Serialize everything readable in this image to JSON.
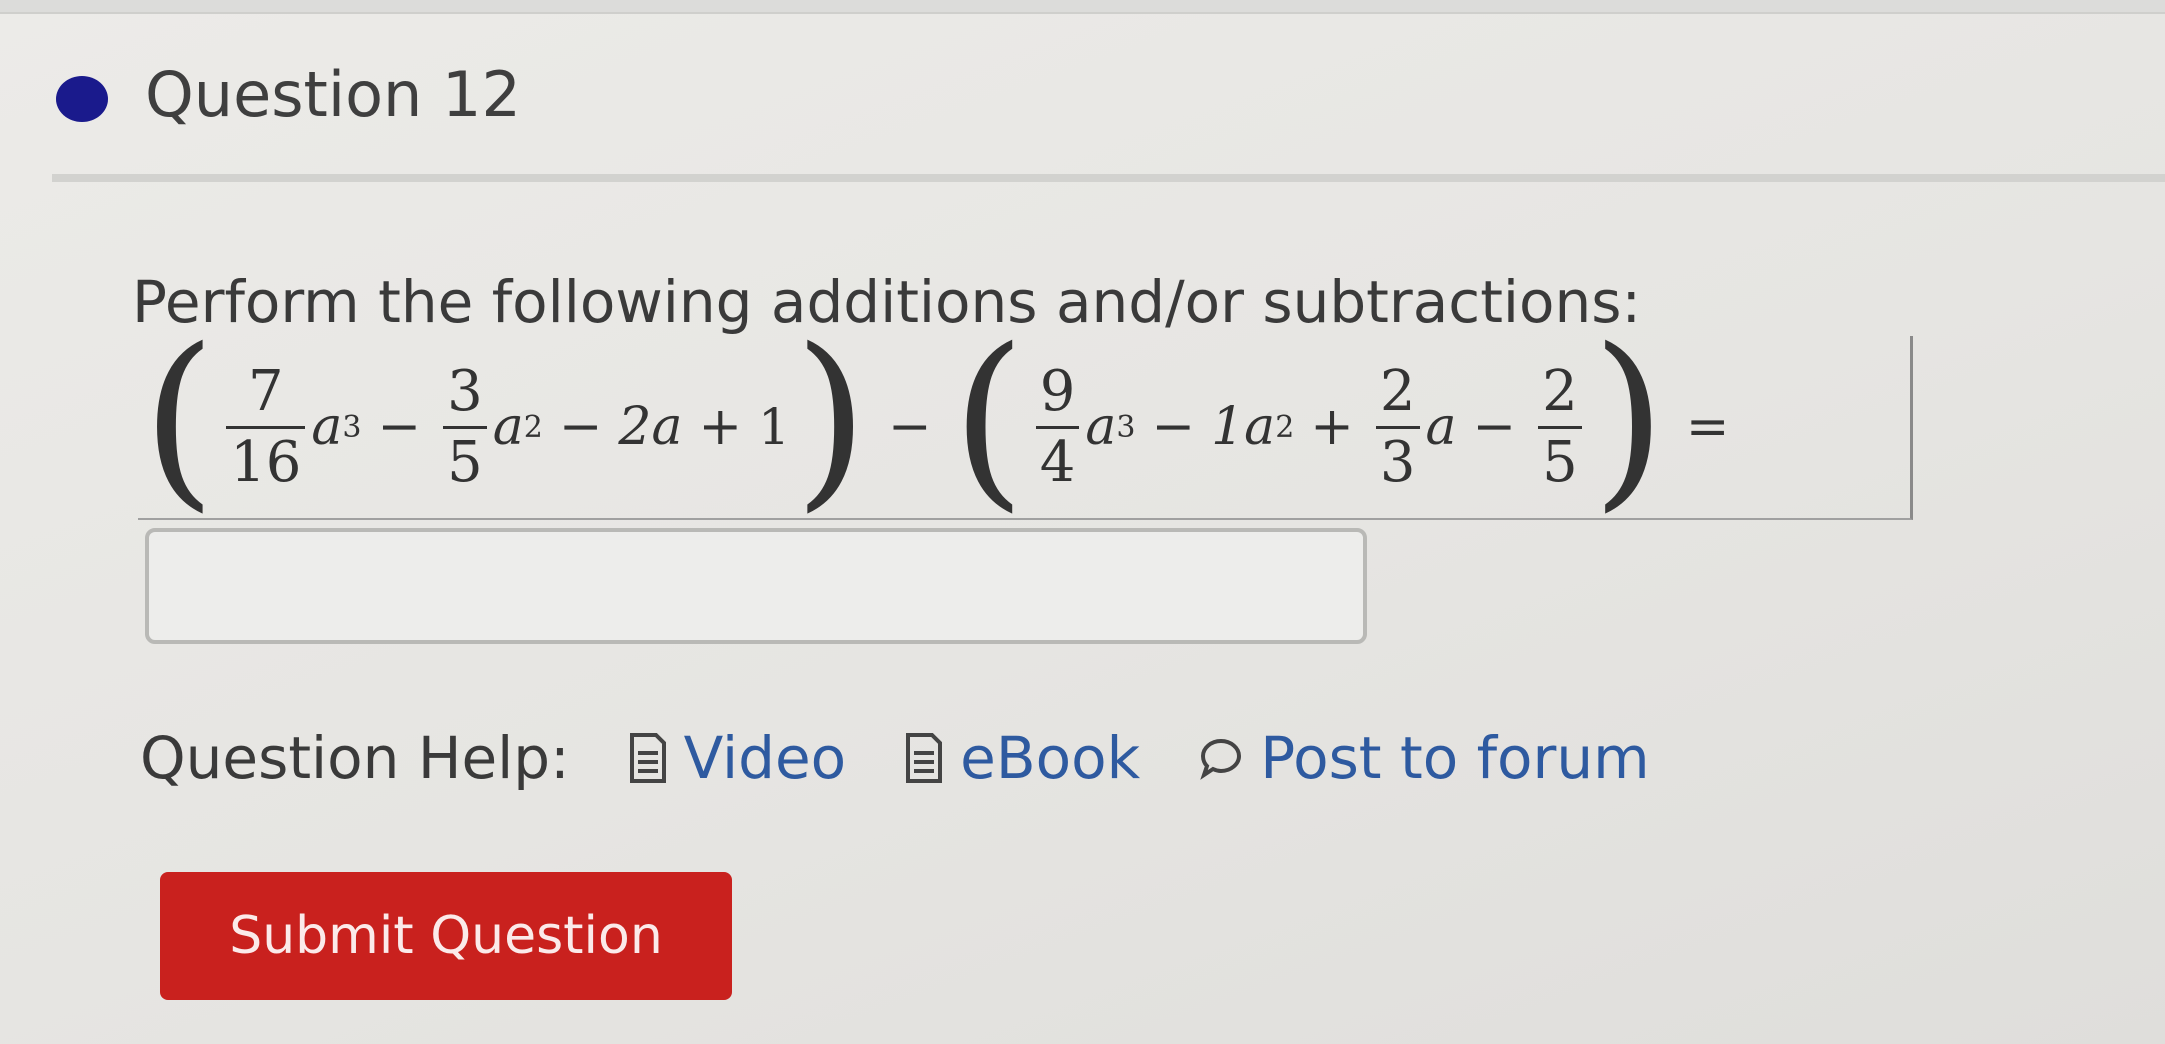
{
  "question": {
    "title": "Question 12"
  },
  "prompt": "Perform the following additions and/or subtractions:",
  "expression": {
    "f1_num": "7",
    "f1_den": "16",
    "var_a": "a",
    "exp3": "3",
    "minus": "−",
    "f2_num": "3",
    "f2_den": "5",
    "exp2": "2",
    "term_2a": "2a",
    "plus": "+",
    "one": "1",
    "f3_num": "9",
    "f3_den": "4",
    "term_1a": "1a",
    "f4_num": "2",
    "f4_den": "3",
    "f5_num": "2",
    "f5_den": "5",
    "equals": "=",
    "lparen": "(",
    "rparen": ")"
  },
  "answer": {
    "value": "",
    "placeholder": ""
  },
  "help": {
    "label": "Question Help:",
    "video": "Video",
    "ebook": "eBook",
    "forum": "Post to forum"
  },
  "submit": {
    "label": "Submit Question"
  },
  "colors": {
    "accent_red": "#c9211e",
    "link_blue": "#2e5aa0",
    "dot_navy": "#1a1a8c"
  },
  "icons": {
    "video": "document-icon",
    "ebook": "document-icon",
    "forum": "speech-bubble-icon"
  }
}
